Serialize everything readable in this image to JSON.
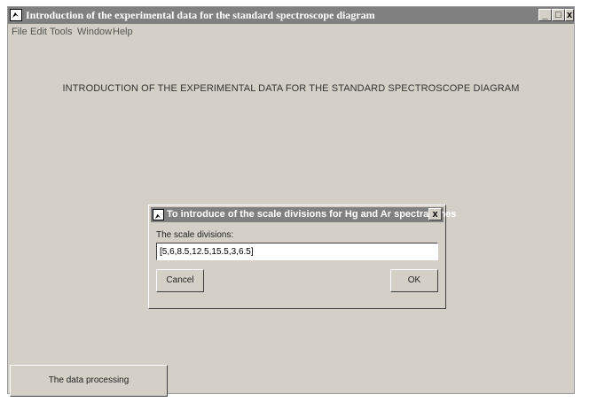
{
  "window": {
    "title": "Introduction of the experimental data for the standard spectroscope diagram",
    "controls": {
      "minimize": "_",
      "maximize": "□",
      "close": "x"
    }
  },
  "menu": [
    "File",
    "Edit",
    "Tools",
    "Window",
    "Help"
  ],
  "main": {
    "heading": "INTRODUCTION OF THE EXPERIMENTAL DATA FOR THE STANDARD SPECTROSCOPE DIAGRAM",
    "process_button": "The data processing"
  },
  "dialog": {
    "title": "To introduce of the scale divisions for Hg and Ar spectral lines",
    "close": "x",
    "label": "The scale divisions:",
    "input_value": "[5,6,8.5,12.5,15.5,3,6.5]",
    "cancel": "Cancel",
    "ok": "OK"
  }
}
